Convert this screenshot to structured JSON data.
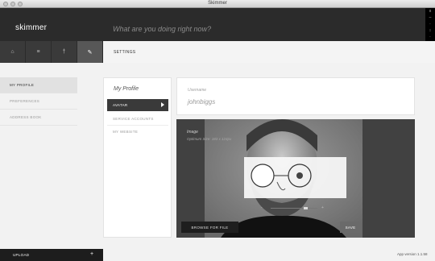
{
  "window": {
    "title": "Skimmer"
  },
  "header": {
    "logo": "skimmer",
    "status_placeholder": "What are you doing right now?",
    "strip_glyphs": [
      "x",
      "–",
      "·",
      "↕",
      "·"
    ]
  },
  "toolbar": {
    "tabs": [
      {
        "icon": "home-icon",
        "glyph": "⌂"
      },
      {
        "icon": "stream-icon",
        "glyph": "≡"
      },
      {
        "icon": "profile-icon",
        "glyph": "†"
      },
      {
        "icon": "wrench-icon",
        "glyph": "✎"
      }
    ],
    "title": "SETTINGS"
  },
  "leftnav": {
    "items": [
      "MY PROFILE",
      "PREFERENCES",
      "ADDRESS BOOK"
    ]
  },
  "upload": {
    "label": "UPLOAD",
    "plus": "+"
  },
  "profile": {
    "title": "My Profile",
    "options": [
      "AVATAR",
      "SERVICE ACCOUNTS",
      "MY WEBSITE"
    ]
  },
  "username": {
    "label": "Username",
    "value": "johnbiggs"
  },
  "image": {
    "label": "Image",
    "hint": "Optimum Size: 183 x 124px",
    "zoom_out": "-",
    "zoom_in": "+",
    "zoom_level": 0.75,
    "browse_label": "BROWSE FOR FILE",
    "save_label": "SAVE"
  },
  "footer": {
    "version": "App version 1.1.58"
  },
  "colors": {
    "header": "#2b2b2b",
    "active": "#3a3a3a",
    "panel": "#414141"
  }
}
